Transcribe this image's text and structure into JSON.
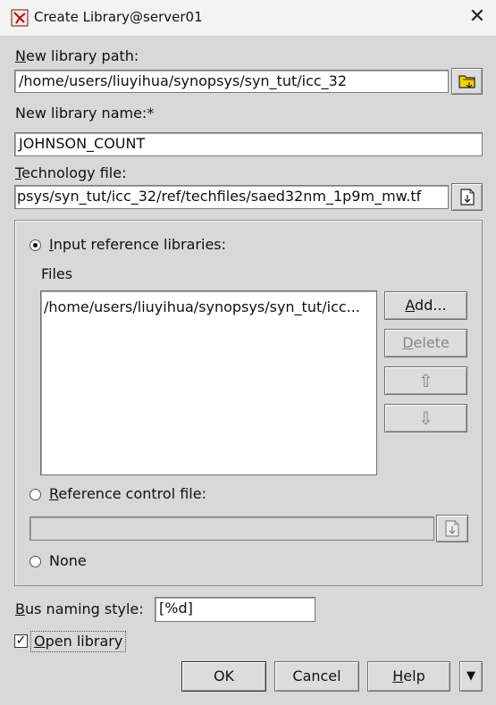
{
  "window": {
    "title": "Create Library@server01",
    "close_glyph": "✕"
  },
  "library_path": {
    "label_first": "N",
    "label_rest": "ew library path:",
    "value": "/home/users/liuyihua/synopsys/syn_tut/icc_32"
  },
  "library_name": {
    "label": "New library name:*",
    "value": "JOHNSON_COUNT"
  },
  "tech_file": {
    "label_first": "T",
    "label_rest": "echnology file:",
    "value": "psys/syn_tut/icc_32/ref/techfiles/saed32nm_1p9m_mw.tf"
  },
  "reference": {
    "input_libs_first": "I",
    "input_libs_rest": "nput reference libraries:",
    "files_label": "Files",
    "files": [
      "/home/users/liuyihua/synopsys/syn_tut/icc..."
    ],
    "add_first": "A",
    "add_rest": "dd...",
    "delete_first": "D",
    "delete_rest": "elete",
    "up_glyph": "⇧",
    "down_glyph": "⇩",
    "control_file_first": "R",
    "control_file_rest": "eference control file:",
    "control_file_value": "",
    "none_label": "None",
    "selected": "input"
  },
  "bus_naming": {
    "label_first": "B",
    "label_rest": "us naming style:",
    "value": "[%d]"
  },
  "open_library": {
    "label_first": "O",
    "label_rest": "pen library",
    "checked": true,
    "check_glyph": "✓"
  },
  "footer": {
    "ok": "OK",
    "cancel": "Cancel",
    "help_first": "H",
    "help_rest": "elp",
    "more_glyph": "▼"
  }
}
